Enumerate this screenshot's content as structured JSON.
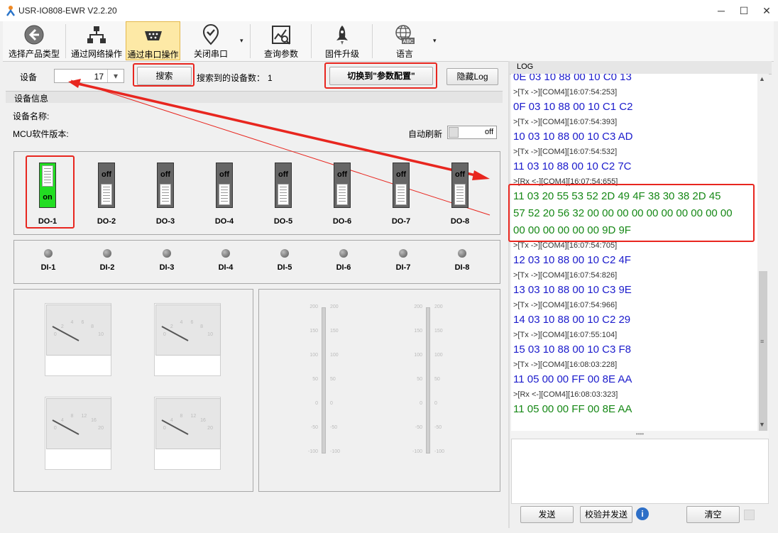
{
  "window": {
    "title": "USR-IO808-EWR V2.2.20",
    "min": "─",
    "max": "☐",
    "close": "✕"
  },
  "toolbar": {
    "items": [
      {
        "label": "选择产品类型",
        "icon": "back-arrow-icon"
      },
      {
        "label": "通过网络操作",
        "icon": "network-icon"
      },
      {
        "label": "通过串口操作",
        "icon": "serial-port-icon",
        "active": true
      },
      {
        "label": "关闭串口",
        "icon": "location-check-icon"
      },
      {
        "label": "查询参数",
        "icon": "query-chart-icon"
      },
      {
        "label": "固件升级",
        "icon": "rocket-icon"
      },
      {
        "label": "语言",
        "icon": "globe-abc-icon"
      }
    ],
    "dropdown_caret": "▾",
    "globe_text": "ABC"
  },
  "device_bar": {
    "device_label": "设备",
    "device_value": "17",
    "dropdown_glyph": "▾",
    "search_button": "搜索",
    "found_label": "搜索到的设备数：",
    "found_count": "1",
    "switch_config_button": "切换到\"参数配置\"",
    "hide_log_button": "隐藏Log"
  },
  "device_info": {
    "title": "设备信息",
    "device_name_label": "设备名称:",
    "mcu_version_label": "MCU软件版本:",
    "auto_refresh_label": "自动刷新",
    "auto_refresh_state": "off"
  },
  "do_outputs": [
    {
      "label": "DO-1",
      "state": "on"
    },
    {
      "label": "DO-2",
      "state": "off"
    },
    {
      "label": "DO-3",
      "state": "off"
    },
    {
      "label": "DO-4",
      "state": "off"
    },
    {
      "label": "DO-5",
      "state": "off"
    },
    {
      "label": "DO-6",
      "state": "off"
    },
    {
      "label": "DO-7",
      "state": "off"
    },
    {
      "label": "DO-8",
      "state": "off"
    }
  ],
  "di_inputs": [
    "DI-1",
    "DI-2",
    "DI-3",
    "DI-4",
    "DI-5",
    "DI-6",
    "DI-7",
    "DI-8"
  ],
  "gauges": {
    "top_ticks": [
      "0",
      "2",
      "4",
      "6",
      "8",
      "10"
    ],
    "bottom_ticks": [
      "0",
      "4",
      "8",
      "12",
      "16",
      "20"
    ]
  },
  "sliders": {
    "ticks": [
      "200",
      "150",
      "100",
      "50",
      "0",
      "-50",
      "-100"
    ]
  },
  "log": {
    "title": "LOG",
    "entries": [
      {
        "kind": "tx",
        "text": "0E 03 10 88 00 10 C0 13"
      },
      {
        "kind": "meta",
        "text": ">[Tx ->][COM4][16:07:54:253]"
      },
      {
        "kind": "tx",
        "text": "0F 03 10 88 00 10 C1 C2"
      },
      {
        "kind": "meta",
        "text": ">[Tx ->][COM4][16:07:54:393]"
      },
      {
        "kind": "tx",
        "text": "10 03 10 88 00 10 C3 AD"
      },
      {
        "kind": "meta",
        "text": ">[Tx ->][COM4][16:07:54:532]"
      },
      {
        "kind": "tx",
        "text": "11 03 10 88 00 10 C2 7C"
      },
      {
        "kind": "meta",
        "text": ">[Rx <-][COM4][16:07:54:655]"
      },
      {
        "kind": "rx",
        "text": "11 03 20 55 53 52 2D 49 4F 38 30 38 2D 45"
      },
      {
        "kind": "rx",
        "text": "57 52 20 56 32 00 00 00 00 00 00 00 00 00 00"
      },
      {
        "kind": "rx",
        "text": "00 00 00 00 00 00 9D 9F"
      },
      {
        "kind": "meta",
        "text": ">[Tx ->][COM4][16:07:54:705]"
      },
      {
        "kind": "tx",
        "text": "12 03 10 88 00 10 C2 4F"
      },
      {
        "kind": "meta",
        "text": ">[Tx ->][COM4][16:07:54:826]"
      },
      {
        "kind": "tx",
        "text": "13 03 10 88 00 10 C3 9E"
      },
      {
        "kind": "meta",
        "text": ">[Tx ->][COM4][16:07:54:966]"
      },
      {
        "kind": "tx",
        "text": "14 03 10 88 00 10 C2 29"
      },
      {
        "kind": "meta",
        "text": ">[Tx ->][COM4][16:07:55:104]"
      },
      {
        "kind": "tx",
        "text": "15 03 10 88 00 10 C3 F8"
      },
      {
        "kind": "meta",
        "text": ">[Tx ->][COM4][16:08:03:228]"
      },
      {
        "kind": "tx",
        "text": "11 05 00 00 FF 00 8E AA"
      },
      {
        "kind": "meta",
        "text": ">[Rx <-][COM4][16:08:03:323]"
      },
      {
        "kind": "rx",
        "text": "11 05 00 00 FF 00 8E AA"
      }
    ],
    "splitter": "••••"
  },
  "bottom_bar": {
    "send_button": "发送",
    "checksum_send_button": "校验并发送",
    "info_glyph": "i",
    "clear_button": "清空"
  },
  "colors": {
    "annotation_red": "#e8261f",
    "tx_blue": "#1b1bcc",
    "rx_green": "#168816",
    "on_green": "#22dd22"
  }
}
